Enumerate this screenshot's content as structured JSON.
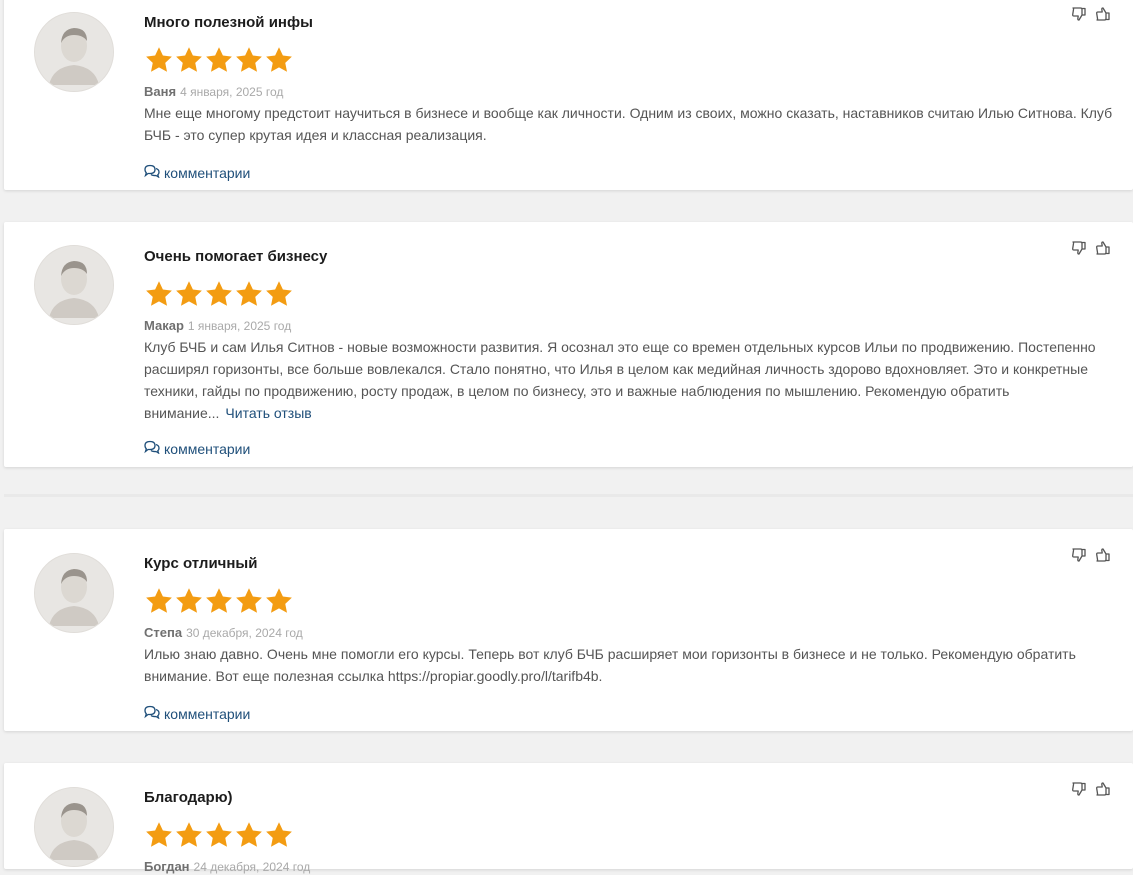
{
  "colors": {
    "star": "#f39c12",
    "link": "#1f4f7a",
    "author": "#707070",
    "date": "#a9a9a9"
  },
  "icons": {
    "avatar": "default-user-avatar-icon",
    "star": "star-icon",
    "dislike": "thumbs-down-icon",
    "like": "thumbs-up-icon",
    "comments": "speech-bubbles-icon"
  },
  "reviews": [
    {
      "title": "Много полезной инфы",
      "rating": 5,
      "author": "Ваня",
      "date": "4 января, 2025 год",
      "text": "Мне еще многому предстоит научиться в бизнесе и вообще как личности. Одним из своих, можно сказать, наставников считаю Илью Ситнова. Клуб БЧБ - это супер крутая идея и классная реализация.",
      "read_more": "",
      "comments_label": "комментарии"
    },
    {
      "title": "Очень помогает бизнесу",
      "rating": 5,
      "author": "Макар",
      "date": "1 января, 2025 год",
      "text": "Клуб БЧБ и сам Илья Ситнов - новые возможности развития. Я осознал это еще со времен отдельных курсов Ильи по продвижению. Постепенно расширял горизонты, все больше вовлекался. Стало понятно, что Илья в целом как медийная личность здорово вдохновляет. Это и конкретные техники, гайды по продвижению, росту продаж, в целом по бизнесу, это и важные наблюдения по мышлению. Рекомендую обратить внимание...",
      "read_more": "Читать отзыв",
      "comments_label": "комментарии"
    },
    {
      "title": "Курс отличный",
      "rating": 5,
      "author": "Степа",
      "date": "30 декабря, 2024 год",
      "text": "Илью знаю давно. Очень мне помогли его курсы. Теперь вот клуб БЧБ расширяет мои горизонты в бизнесе и не только. Рекомендую обратить внимание. Вот еще полезная ссылка https://propiar.goodly.pro/l/tarifb4b.",
      "read_more": "",
      "comments_label": "комментарии"
    },
    {
      "title": "Благодарю)",
      "rating": 5,
      "author": "Богдан",
      "date": "24 декабря, 2024 год",
      "text": "",
      "read_more": "",
      "comments_label": ""
    }
  ]
}
